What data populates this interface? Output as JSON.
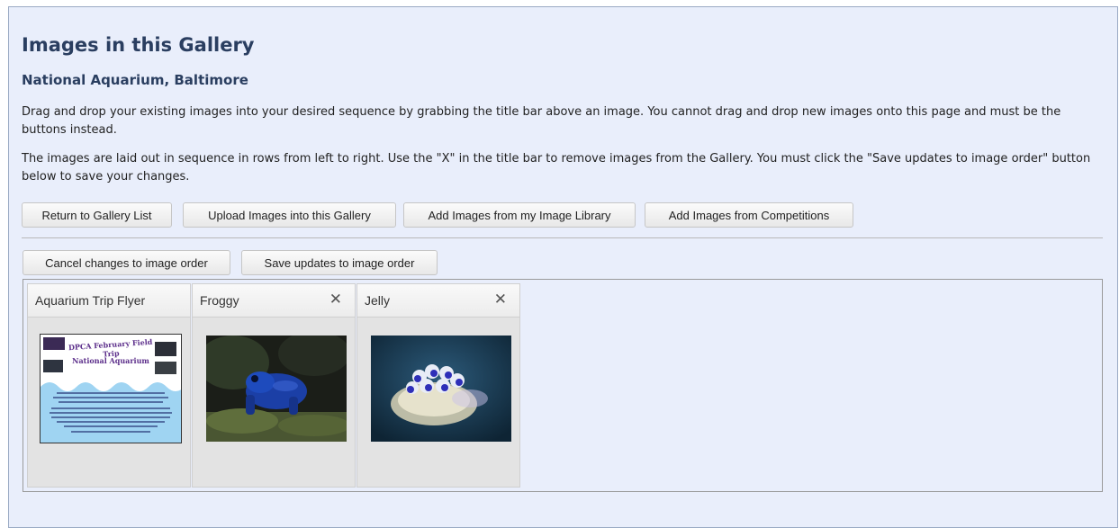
{
  "header": {
    "title": "Images in this Gallery",
    "subtitle": "National Aquarium, Baltimore"
  },
  "instructions": {
    "paragraph1": "Drag and drop your existing images into your desired sequence by grabbing the title bar above an image. You cannot drag and drop new images onto this page and must be the buttons instead.",
    "paragraph2": "The images are laid out in sequence in rows from left to right. Use the \"X\" in the title bar to remove images from the Gallery. You must click the \"Save updates to image order\" button below to save your changes."
  },
  "actions": {
    "return_label": "Return to Gallery List",
    "upload_label": "Upload Images into this Gallery",
    "library_label": "Add Images from my Image Library",
    "competitions_label": "Add Images from Competitions"
  },
  "order_actions": {
    "cancel_label": "Cancel changes to image order",
    "save_label": "Save updates to image order"
  },
  "tiles": [
    {
      "title": "Aquarium Trip Flyer",
      "close": "",
      "thumbnail": "event-flyer-thumbnail"
    },
    {
      "title": "Froggy",
      "close": "✕",
      "thumbnail": "blue-frog-photo"
    },
    {
      "title": "Jelly",
      "close": "✕",
      "thumbnail": "jellyfish-photo"
    }
  ],
  "flyer": {
    "heading": "DPCA February Field Trip",
    "subheading": "National Aquarium"
  },
  "colors": {
    "panel_bg": "#e9eefb",
    "heading": "#2a3e60"
  }
}
